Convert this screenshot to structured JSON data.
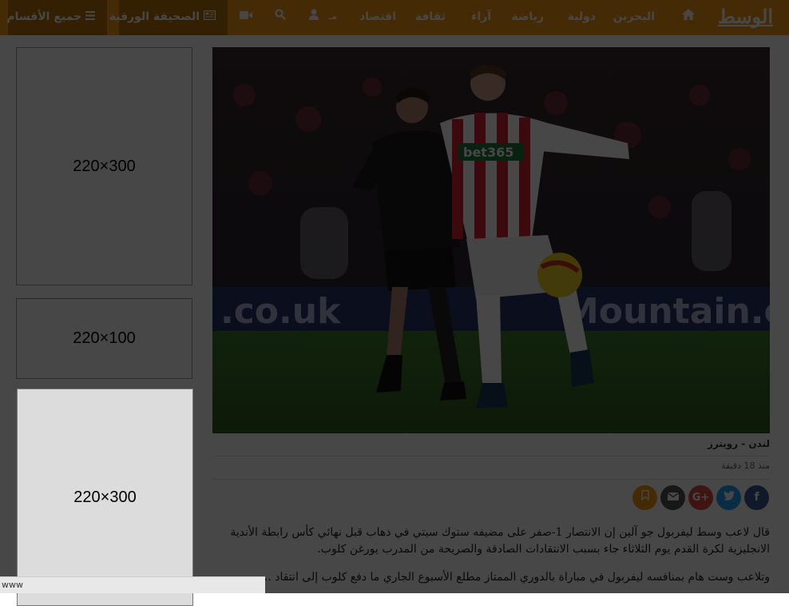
{
  "nav": {
    "logo": "الوسط",
    "items": [
      {
        "id": "bahrain",
        "label": "البحرين"
      },
      {
        "id": "international",
        "label": "دولية"
      },
      {
        "id": "sports",
        "label": "رياضة"
      },
      {
        "id": "opinions",
        "label": "آراء"
      },
      {
        "id": "culture",
        "label": "ثقافة"
      },
      {
        "id": "economy",
        "label": "اقتصاد"
      },
      {
        "id": "misc",
        "label": "مـ"
      }
    ],
    "paper_label": "الصحيفة الورقية",
    "all_sections_label": "جميع الأقسام",
    "icons": [
      "home-icon",
      "user-icon",
      "search-icon",
      "video-icon",
      "newspaper-icon",
      "menu-icon"
    ],
    "accent_color": "#f39c12",
    "dark_accent_color": "#b8730a"
  },
  "article": {
    "caption": "لندن - رويترز",
    "time_ago": "منذ 18 دقيقة",
    "share": {
      "facebook_color": "#3b5998",
      "twitter_color": "#1da1f2",
      "google_color": "#dd4b39",
      "email_color": "#555555",
      "bookmark_color": "#f39c12"
    },
    "paragraph1": "قال لاعب وسط ليفربول جو آلين إن الانتصار 1-صفر على مضيفه ستوك سيتي في ذهاب قبل نهائي كأس رابطة الأندية الانجليزية لكرة القدم يوم الثلاثاء جاء بسبب الانتقادات الصادقة والصريحة من المدرب يورغن كلوب.",
    "paragraph2": "وتلاعب وست هام بمنافسه ليفربول في مباراة بالدوري الممتاز مطلع الأسبوع الجاري ما دفع كلوب إلى انتقاد ...",
    "image_text": {
      "sponsor": "bet365",
      "banner_left": ".co.uk",
      "banner_right": "Mountain.co"
    }
  },
  "ads": [
    {
      "label": "220×300"
    },
    {
      "label": "220×100"
    },
    {
      "label": "220×300"
    }
  ],
  "status_bar": "www"
}
